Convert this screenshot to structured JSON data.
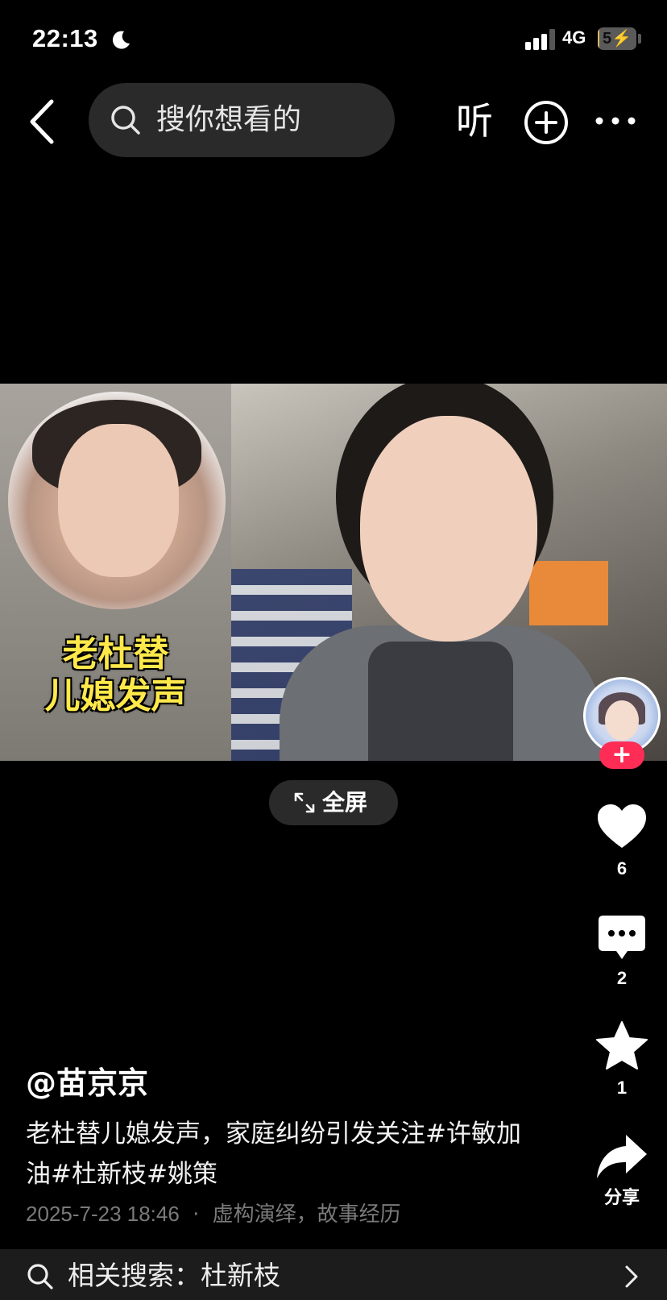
{
  "status_bar": {
    "time": "22:13",
    "network": "4G",
    "battery_level": "5",
    "battery_fill_fraction": 0.05,
    "signal_bars": 3
  },
  "nav": {
    "search_placeholder": "搜你想看的",
    "listen_label": "听"
  },
  "video": {
    "overlay_caption": "老杜替\n儿媳发声",
    "fullscreen_label": "全屏"
  },
  "actions": {
    "likes": "6",
    "comments": "2",
    "favorites": "1",
    "share_label": "分享",
    "follow_label": "+"
  },
  "post": {
    "author": "@苗京京",
    "description": "老杜替儿媳发声，家庭纠纷引发关注#许敏加油#杜新枝#姚策",
    "date": "2025-7-23 18:46",
    "separator": "·",
    "tag_note": "虚构演绎，故事经历"
  },
  "related": {
    "text": "相关搜索：杜新枝"
  },
  "colors": {
    "background": "#000000",
    "accent_follow": "#ff2c55",
    "caption_yellow": "#ffe94a",
    "meta_gray": "#7a7a7a"
  }
}
